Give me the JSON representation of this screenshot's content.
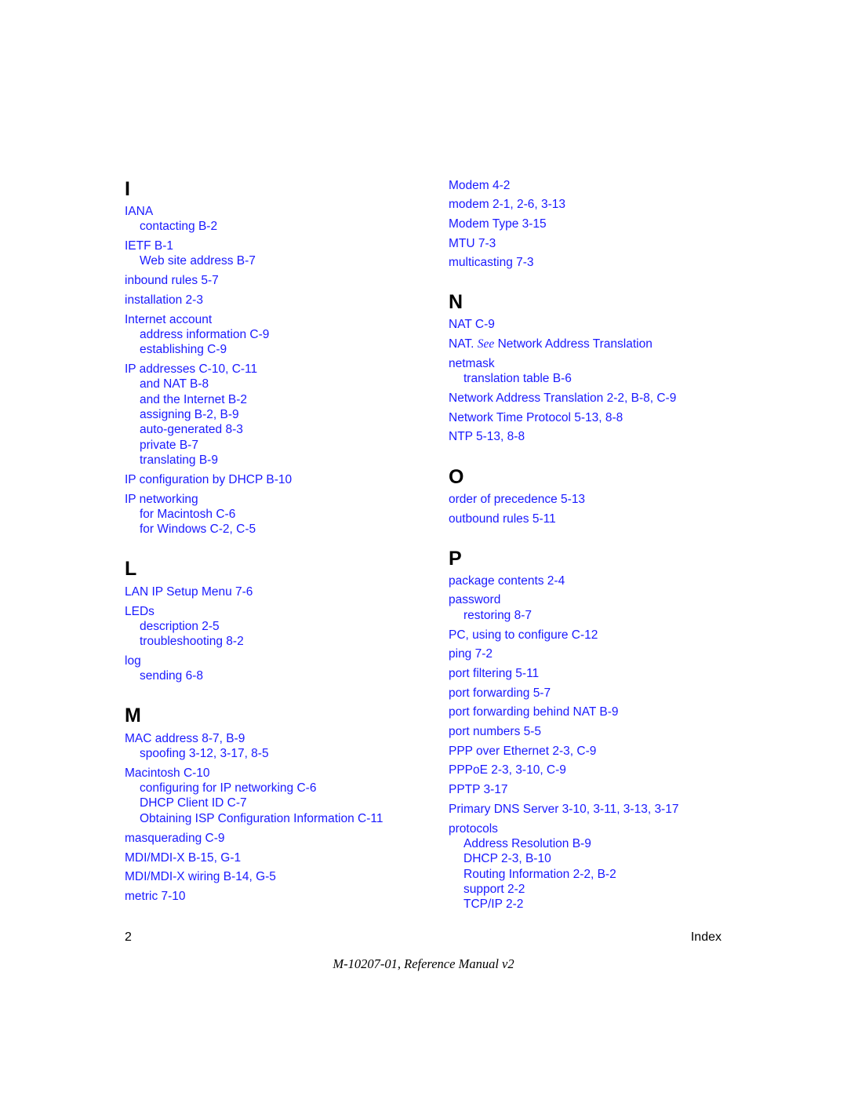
{
  "index": {
    "left": [
      {
        "letter": "I",
        "entries": [
          {
            "text": "IANA",
            "sub": false
          },
          {
            "text": "contacting  B-2",
            "sub": true
          },
          {
            "text": "IETF  B-1",
            "sub": false
          },
          {
            "text": "Web site address  B-7",
            "sub": true
          },
          {
            "text": "inbound rules  5-7",
            "sub": false
          },
          {
            "text": "installation  2-3",
            "sub": false
          },
          {
            "text": "Internet account",
            "sub": false
          },
          {
            "text": "address information  C-9",
            "sub": true
          },
          {
            "text": "establishing  C-9",
            "sub": true
          },
          {
            "text": "IP addresses  C-10, C-11",
            "sub": false
          },
          {
            "text": "and NAT  B-8",
            "sub": true
          },
          {
            "text": "and the Internet  B-2",
            "sub": true
          },
          {
            "text": "assigning  B-2, B-9",
            "sub": true
          },
          {
            "text": "auto-generated  8-3",
            "sub": true
          },
          {
            "text": "private  B-7",
            "sub": true
          },
          {
            "text": "translating  B-9",
            "sub": true
          },
          {
            "text": "IP configuration by DHCP  B-10",
            "sub": false
          },
          {
            "text": "IP networking",
            "sub": false
          },
          {
            "text": "for Macintosh  C-6",
            "sub": true
          },
          {
            "text": "for Windows  C-2, C-5",
            "sub": true
          }
        ]
      },
      {
        "letter": "L",
        "entries": [
          {
            "text": "LAN IP Setup Menu  7-6",
            "sub": false
          },
          {
            "text": "LEDs",
            "sub": false
          },
          {
            "text": "description  2-5",
            "sub": true
          },
          {
            "text": "troubleshooting  8-2",
            "sub": true
          },
          {
            "text": "log",
            "sub": false
          },
          {
            "text": "sending  6-8",
            "sub": true
          }
        ]
      },
      {
        "letter": "M",
        "entries": [
          {
            "text": "MAC address  8-7, B-9",
            "sub": false
          },
          {
            "text": "spoofing  3-12, 3-17, 8-5",
            "sub": true
          },
          {
            "text": "Macintosh  C-10",
            "sub": false
          },
          {
            "text": "configuring for IP networking  C-6",
            "sub": true
          },
          {
            "text": "DHCP Client ID  C-7",
            "sub": true
          },
          {
            "text": "Obtaining ISP Configuration Information  C-11",
            "sub": true
          },
          {
            "text": "masquerading  C-9",
            "sub": false
          },
          {
            "text": "MDI/MDI-X  B-15, G-1",
            "sub": false
          },
          {
            "text": "MDI/MDI-X wiring  B-14, G-5",
            "sub": false
          },
          {
            "text": "metric  7-10",
            "sub": false
          }
        ]
      }
    ],
    "right": [
      {
        "letter": "",
        "entries": [
          {
            "text": "Modem  4-2",
            "sub": false
          },
          {
            "text": "modem  2-1, 2-6, 3-13",
            "sub": false
          },
          {
            "text": "Modem Type  3-15",
            "sub": false
          },
          {
            "text": "MTU  7-3",
            "sub": false
          },
          {
            "text": "multicasting  7-3",
            "sub": false
          }
        ]
      },
      {
        "letter": "N",
        "entries": [
          {
            "text": "NAT  C-9",
            "sub": false
          },
          {
            "text": "NAT. ",
            "see": "See",
            "after": " Network Address Translation",
            "sub": false
          },
          {
            "text": "netmask",
            "sub": false
          },
          {
            "text": "translation table  B-6",
            "sub": true
          },
          {
            "text": "Network Address Translation  2-2, B-8, C-9",
            "sub": false
          },
          {
            "text": "Network Time Protocol  5-13, 8-8",
            "sub": false
          },
          {
            "text": "NTP  5-13, 8-8",
            "sub": false
          }
        ]
      },
      {
        "letter": "O",
        "entries": [
          {
            "text": "order of precedence  5-13",
            "sub": false
          },
          {
            "text": "outbound rules  5-11",
            "sub": false
          }
        ]
      },
      {
        "letter": "P",
        "entries": [
          {
            "text": "package contents  2-4",
            "sub": false
          },
          {
            "text": "password",
            "sub": false
          },
          {
            "text": "restoring  8-7",
            "sub": true
          },
          {
            "text": "PC, using to configure  C-12",
            "sub": false
          },
          {
            "text": "ping  7-2",
            "sub": false
          },
          {
            "text": "port filtering  5-11",
            "sub": false
          },
          {
            "text": "port forwarding  5-7",
            "sub": false
          },
          {
            "text": "port forwarding behind NAT  B-9",
            "sub": false
          },
          {
            "text": "port numbers  5-5",
            "sub": false
          },
          {
            "text": "PPP over Ethernet  2-3, C-9",
            "sub": false
          },
          {
            "text": "PPPoE  2-3, 3-10, C-9",
            "sub": false
          },
          {
            "text": "PPTP  3-17",
            "sub": false
          },
          {
            "text": "Primary DNS Server  3-10, 3-11, 3-13, 3-17",
            "sub": false
          },
          {
            "text": "protocols",
            "sub": false
          },
          {
            "text": "Address Resolution  B-9",
            "sub": true
          },
          {
            "text": "DHCP  2-3, B-10",
            "sub": true
          },
          {
            "text": "Routing Information  2-2, B-2",
            "sub": true
          },
          {
            "text": "support  2-2",
            "sub": true
          },
          {
            "text": "TCP/IP  2-2",
            "sub": true
          }
        ]
      }
    ]
  },
  "footer": {
    "page_number": "2",
    "section": "Index",
    "title": "M-10207-01, Reference Manual v2"
  }
}
